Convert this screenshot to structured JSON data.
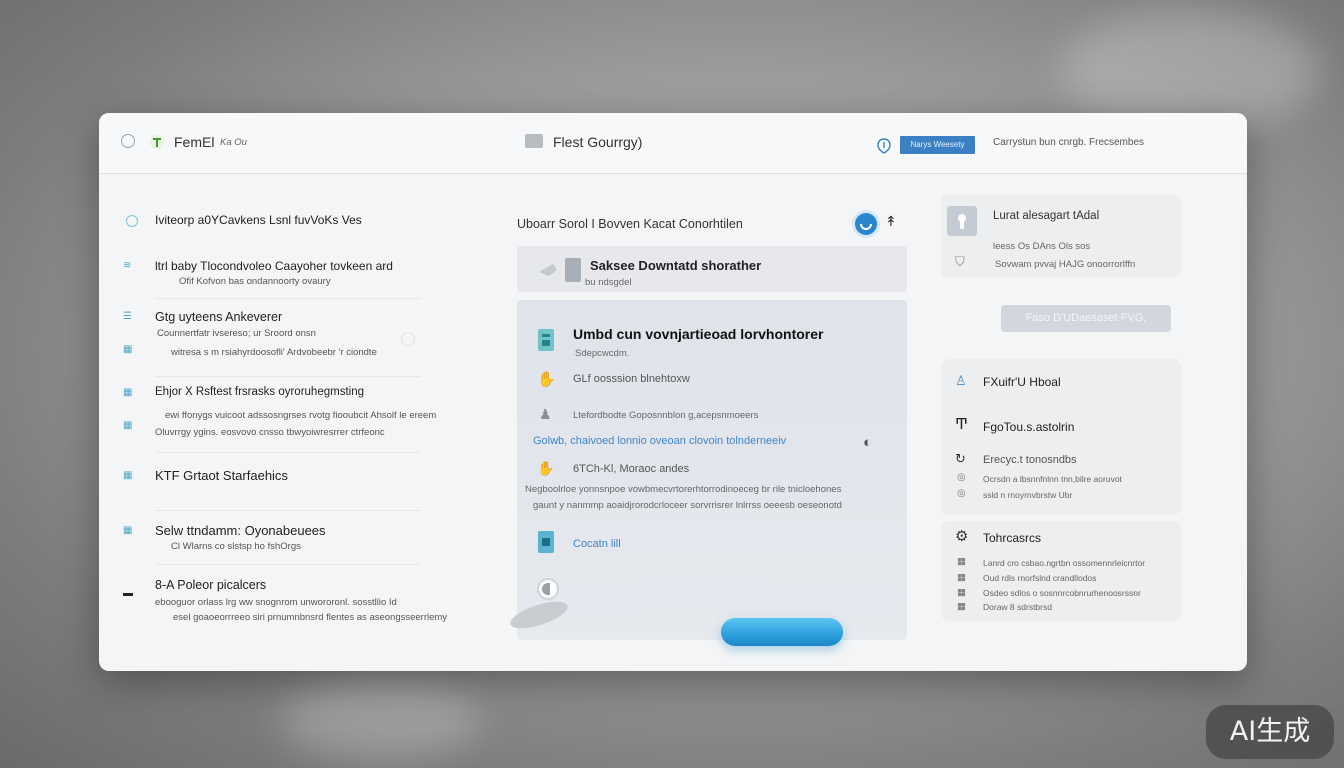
{
  "header": {
    "app_name": "FemEl",
    "app_name_suffix": "Ka Ou",
    "center_title": "Flest Gourrgy)",
    "primary_button": "Narys Weesety",
    "links": "Carrystun bun cnrgb.",
    "links_2": "Frecsembes"
  },
  "left": {
    "items": [
      {
        "title": "Iviteorp a0YCavkens Lsnl fuvVoKs Ves",
        "sub": ""
      },
      {
        "title": "ltrl baby Tlocondvoleo Caayoher tovkeen ard",
        "sub": "Ofif Kofvon bas ondannoorty ovaury"
      },
      {
        "title": "Gtg uyteens Ankeverer",
        "sub": "Counnertfatr ivsereso; ur Sroord onsn",
        "sub2": "witresa s m rsiahyrdoosofli' Ardvobeebr 'r ciondte"
      },
      {
        "title": "Ehjor X Rsftest frsrasks oyroruhegmsting",
        "sub": "ewi ffonygs vuicoot adssosngrses rvotg fiooubcit Ahsolf le ereem",
        "sub2": "Oluvrrgy ygins. eosvovo cnsso tbwyoiwresrrer ctrfeonc"
      },
      {
        "title": "KTF Grtaot Starfaehics",
        "sub": ""
      },
      {
        "title": "Selw ttndamm: Oyonabeuees",
        "sub": "Cl Wlarns      co slstsp ho fshOrgs"
      },
      {
        "title": "8-A Poleor picalcers",
        "sub": "ebooguor orlass lrg ww snognrom unwororonl. sosstllio Id",
        "sub2": "esel goaoeorrreeo siri prnumnbnsrd flentes as aseongsseerrlemy"
      }
    ]
  },
  "center": {
    "header_title": "Uboarr Sorol I Bovven Kacat Conorhtilen",
    "banner_title": "Saksee Downtatd shorather",
    "banner_sub": "bu ndsgdel",
    "card_title": "Umbd cun vovnjartieoad lorvhontorer",
    "card_sub": "Sdepcwcdm.",
    "row1": "GLf oosssion blnehtoxw",
    "row2": "Ltefordbodte Goposnnblon g,acepsnmoeers",
    "row3_link": "Golwb, chaivoed lonnio oveoan clovoin tolnderneeiv",
    "row4": "6TCh-Kl, Moraoc andes",
    "para1": "Negboolrloe yonnsnpoe vowbmecvrtorerhtorrodinoeceg br rile tnicloehones",
    "para2": "gaunt y nanmmp aoaidjrorodcrloceer sorvrrisrer lnlrrss oeeesb oeseonotd",
    "link": "Cocatn lill",
    "accent": "#2b9fdc"
  },
  "right": {
    "card1_title": "Lurat alesagart tAdal",
    "card1_line1": "leess  Os  DAns  Ols sos",
    "card1_line2": "Sovwam pvvaj  HAJG  onoorrorlffn",
    "pill_button": "Faso D'UDaesaset FVG,",
    "card2_item1": "FXuifr'U Hboal",
    "card2_item2": "FgoTou.s.astolrin",
    "card2_item3": "Erecyc.t tonosndbs",
    "card2_line1": "Ocrsdn a lbsnnfnlnn tnn,bilre aoruvot",
    "card2_line2": "ssld n rnoyrnvbrstw Ubr",
    "card3_title": "Tohrcasrcs",
    "card3_line1": "Lanrd cro csbao.ngrtbn ossomennrleicnrtor",
    "card3_line2": "Oud rdls rnorfslnd crandllodos",
    "card3_line3": "Osdeo sdlos o sosnnrcobnrurhenoosrssnr",
    "card3_line4": "Doraw 8 sdrstbrsd"
  },
  "watermark": "AI生成"
}
